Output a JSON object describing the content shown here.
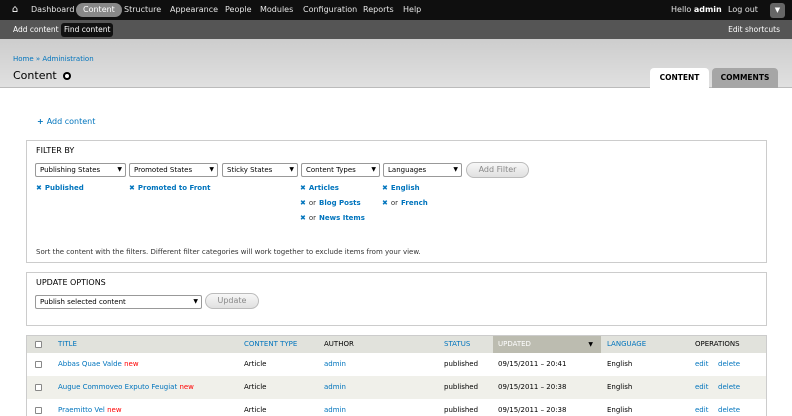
{
  "toolbar": {
    "menu": [
      "Dashboard",
      "Content",
      "Structure",
      "Appearance",
      "People",
      "Modules",
      "Configuration",
      "Reports",
      "Help"
    ],
    "active_index": 1,
    "hello_prefix": "Hello",
    "username": "admin",
    "logout": "Log out"
  },
  "shortcuts": {
    "items": [
      "Add content",
      "Find content"
    ],
    "active_index": 1,
    "edit": "Edit shortcuts"
  },
  "breadcrumb": "Home » Administration",
  "page_title": "Content",
  "tabs": [
    "CONTENT",
    "COMMENTS"
  ],
  "active_tab": 0,
  "add_content": "Add content",
  "filter": {
    "legend": "FILTER BY",
    "selects": [
      "Publishing States",
      "Promoted States",
      "Sticky States",
      "Content Types",
      "Languages"
    ],
    "add_filter_button": "Add Filter",
    "active_filters": {
      "status": "Published",
      "promote": "Promoted to Front",
      "types": [
        "Articles",
        "Blog Posts",
        "News Items"
      ],
      "languages": [
        "English",
        "French"
      ],
      "or": "or"
    },
    "note": "Sort the content with the filters. Different filter categories will work together to exclude items from your view."
  },
  "update": {
    "legend": "UPDATE OPTIONS",
    "selected_action": "Publish selected content",
    "button": "Update"
  },
  "table": {
    "headers": [
      "TITLE",
      "CONTENT TYPE",
      "AUTHOR",
      "STATUS",
      "UPDATED",
      "LANGUAGE",
      "OPERATIONS"
    ],
    "sorted_column": "UPDATED",
    "new_marker": "new",
    "operations": [
      "edit",
      "delete"
    ],
    "rows": [
      {
        "title": "Abbas Quae Valde",
        "type": "Article",
        "author": "admin",
        "status": "published",
        "updated": "09/15/2011 – 20:41",
        "language": "English"
      },
      {
        "title": "Augue Commoveo Exputo Feugiat",
        "type": "Article",
        "author": "admin",
        "status": "published",
        "updated": "09/15/2011 – 20:38",
        "language": "English"
      },
      {
        "title": "Praemitto Vel",
        "type": "Article",
        "author": "admin",
        "status": "published",
        "updated": "09/15/2011 – 20:38",
        "language": "English"
      }
    ]
  }
}
